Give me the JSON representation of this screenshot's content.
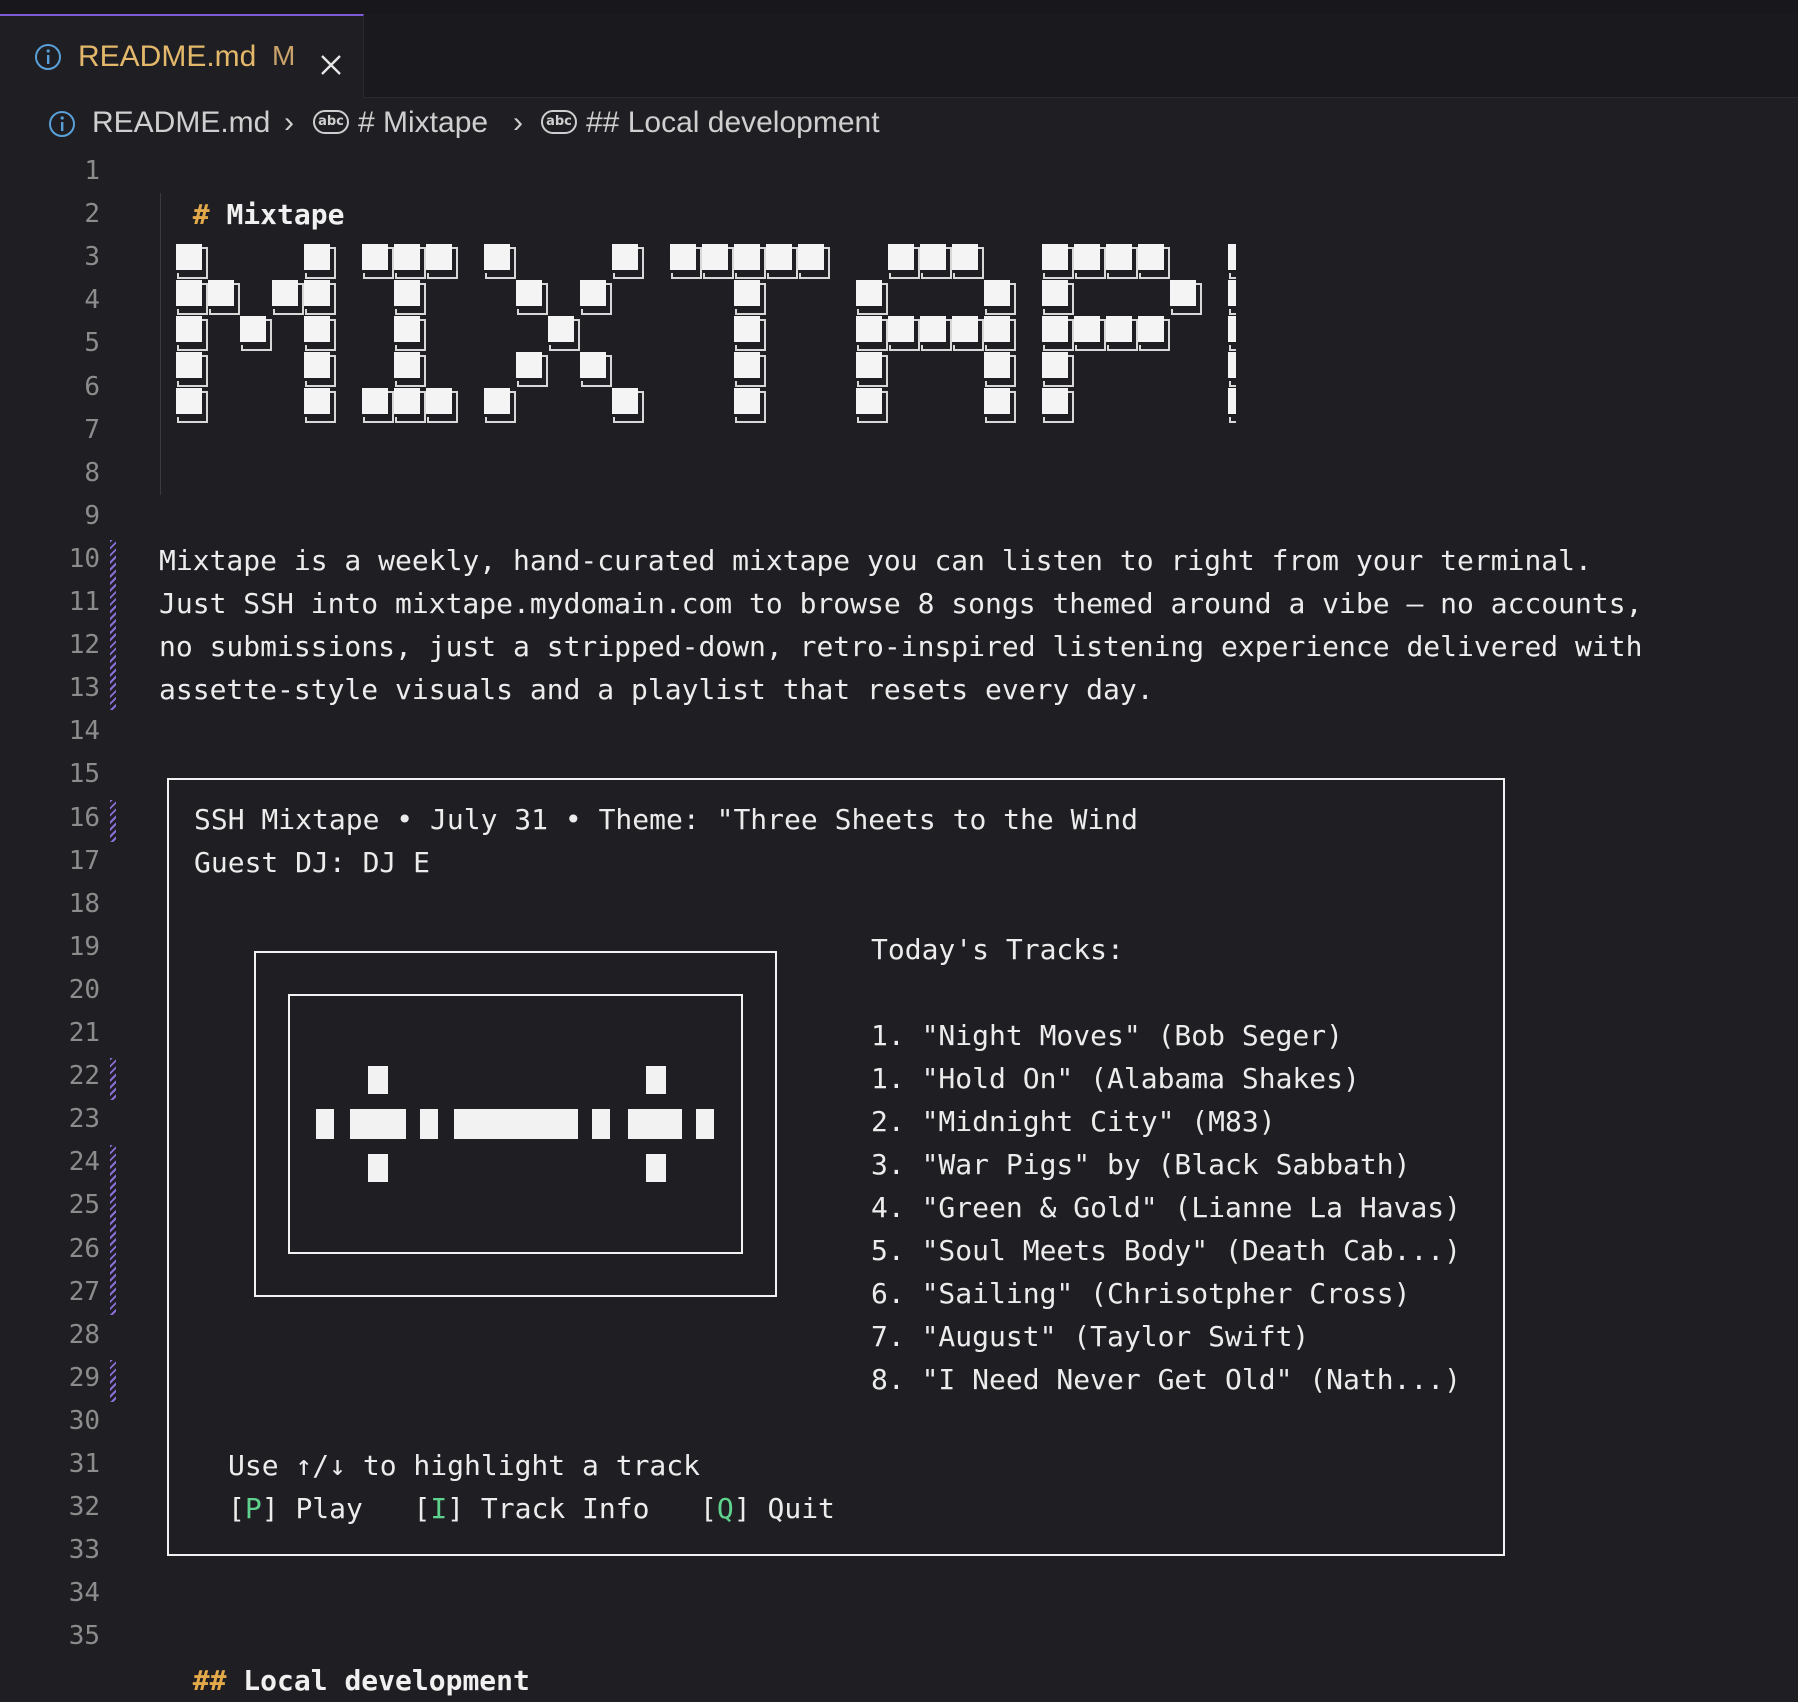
{
  "tab": {
    "label": "README.md",
    "modified": "M"
  },
  "breadcrumb": {
    "file": "README.md",
    "section1": "# Mixtape",
    "section2": "## Local development",
    "symbol_badge": "abc"
  },
  "gutter": [
    "1",
    "2",
    "3",
    "4",
    "5",
    "6",
    "7",
    "8",
    "9",
    "10",
    "11",
    "12",
    "13",
    "14",
    "15",
    "16",
    "17",
    "18",
    "19",
    "20",
    "21",
    "22",
    "23",
    "24",
    "25",
    "26",
    "27",
    "28",
    "29",
    "30",
    "31",
    "32",
    "33",
    "34",
    "35"
  ],
  "editor": {
    "line1_hash": "#",
    "line1_title": "Mixtape",
    "description": [
      "Mixtape is a weekly, hand-curated mixtape you can listen to right from your terminal.",
      "Just SSH into mixtape.mydomain.com to browse 8 songs themed around a vibe — no accounts,",
      "no submissions, just a stripped-down, retro-inspired listening experience delivered with",
      "assette-style visuals and a playlist that resets every day."
    ],
    "header_line": "SSH Mixtape • July 31 • Theme: \"Three Sheets to the Wind",
    "guest_line": "Guest DJ: DJ E",
    "tracks_title": "Today's Tracks:",
    "tracks": [
      "1. \"Night Moves\" (Bob Seger)",
      "1. \"Hold On\" (Alabama Shakes)",
      "2. \"Midnight City\" (M83)",
      "3. \"War Pigs\" by (Black Sabbath)",
      "4. \"Green & Gold\" (Lianne La Havas)",
      "5. \"Soul Meets Body\" (Death Cab...)",
      "6. \"Sailing\" (Chrisotpher Cross)",
      "7. \"August\" (Taylor Swift)",
      "8. \"I Need Never Get Old\" (Nath...)"
    ],
    "help_line": "Use ↑/↓ to highlight a track",
    "keys": {
      "play_key": "P",
      "play_label": "Play",
      "info_key": "I",
      "info_label": "Track Info",
      "quit_key": "Q",
      "quit_label": "Quit"
    },
    "line35_hash": "##",
    "line35_title": "Local development"
  },
  "banner_text": "MIXTAPE",
  "colors": {
    "accent": "#7c5cd6",
    "heading_hash": "#e3a84a",
    "key_green": "#5fd38d",
    "tab_label": "#e3b86b"
  }
}
